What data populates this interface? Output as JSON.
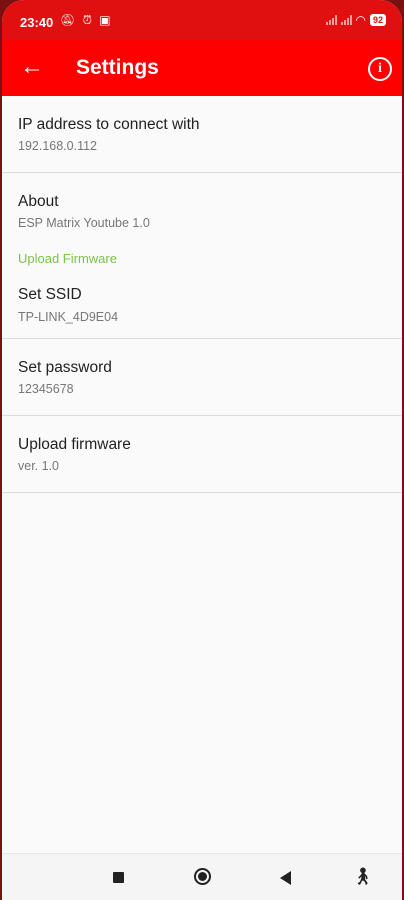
{
  "status_bar": {
    "time": "23:40",
    "battery": "92"
  },
  "app_bar": {
    "title": "Settings"
  },
  "preferences": {
    "ip": {
      "title": "IP address to connect with",
      "summary": "192.168.0.112"
    },
    "about": {
      "title": "About",
      "summary": "ESP Matrix Youtube 1.0"
    },
    "category": "Upload Firmware",
    "ssid": {
      "title": "Set SSID",
      "summary": "TP-LINK_4D9E04"
    },
    "password": {
      "title": "Set password",
      "summary": "12345678"
    },
    "firmware": {
      "title": "Upload firmware",
      "summary": "ver. 1.0"
    }
  },
  "colors": {
    "app_bar": "#ff0000",
    "status_bar": "#e01010",
    "category_accent": "#7cc24a"
  }
}
